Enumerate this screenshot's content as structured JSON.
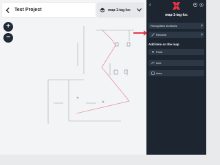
{
  "header": {
    "project_title": "Test Project",
    "map_name": "map-1-tag-loc"
  },
  "zoom": {
    "zoom_in_label": "+",
    "zoom_out_label": "−"
  },
  "panel": {
    "back_label": "‹",
    "title": "map-1-tag-loc",
    "recognition_label": "Recognition shortcuts",
    "rename_label": "Rename",
    "section_title": "Add item on the map",
    "point_label": "Point",
    "line_label": "Line",
    "area_label": "Area"
  },
  "colors": {
    "panel_bg": "#1c2530",
    "button_bg": "#2c3846",
    "accent_red": "#e3374a",
    "route_pink": "#ea8f9e"
  }
}
